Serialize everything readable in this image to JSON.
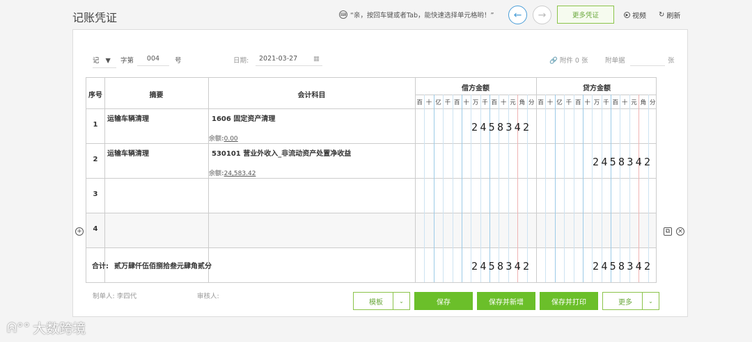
{
  "app": {
    "title": "记账凭证"
  },
  "tip": {
    "icon": "keyboard-icon",
    "text": "“亲，按回车键或者Tab，能快速选择单元格哟！”"
  },
  "top_actions": {
    "more_vouchers": "更多凭证",
    "video": "视频",
    "refresh": "刷新"
  },
  "header": {
    "voucher_type": "记",
    "word_label": "字第",
    "number": "004",
    "number_suffix": "号",
    "date_label": "日期:",
    "date": "2021-03-27",
    "attachment_label": "附件 0 张",
    "attached_docs_label": "附单据",
    "attached_docs_suffix": "张"
  },
  "table": {
    "col_seq": "序号",
    "col_summary": "摘要",
    "col_account": "会计科目",
    "col_debit": "借方金额",
    "col_credit": "贷方金额",
    "digit_units": [
      "百",
      "十",
      "亿",
      "千",
      "百",
      "十",
      "万",
      "千",
      "百",
      "十",
      "元",
      "角",
      "分"
    ],
    "rows": [
      {
        "seq": "1",
        "summary": "运输车辆清理",
        "account": "1606 固定资产清理",
        "balance_label": "余额:",
        "balance": "0.00",
        "debit": "2458342",
        "credit": ""
      },
      {
        "seq": "2",
        "summary": "运输车辆清理",
        "account": "530101 营业外收入_非流动资产处置净收益",
        "balance_label": "余额:",
        "balance": "24,583.42",
        "debit": "",
        "credit": "2458342"
      },
      {
        "seq": "3",
        "summary": "",
        "account": "",
        "balance_label": "",
        "balance": "",
        "debit": "",
        "credit": ""
      },
      {
        "seq": "4",
        "summary": "",
        "account": "",
        "balance_label": "",
        "balance": "",
        "debit": "",
        "credit": ""
      }
    ],
    "total_label": "合计:",
    "total_words": "贰万肆仟伍佰捌拾叁元肆角贰分",
    "total_debit": "2458342",
    "total_credit": "2458342"
  },
  "footer": {
    "maker_label": "制单人:",
    "maker": "李四代",
    "reviewer_label": "审核人:",
    "template": "模板",
    "save": "保存",
    "save_new": "保存并新增",
    "save_print": "保存并打印",
    "more": "更多"
  },
  "watermark": "大数跨境",
  "colors": {
    "accent_green": "#6bbf2a",
    "accent_blue": "#4a9ed8",
    "red_line": "#f0b4b4"
  }
}
